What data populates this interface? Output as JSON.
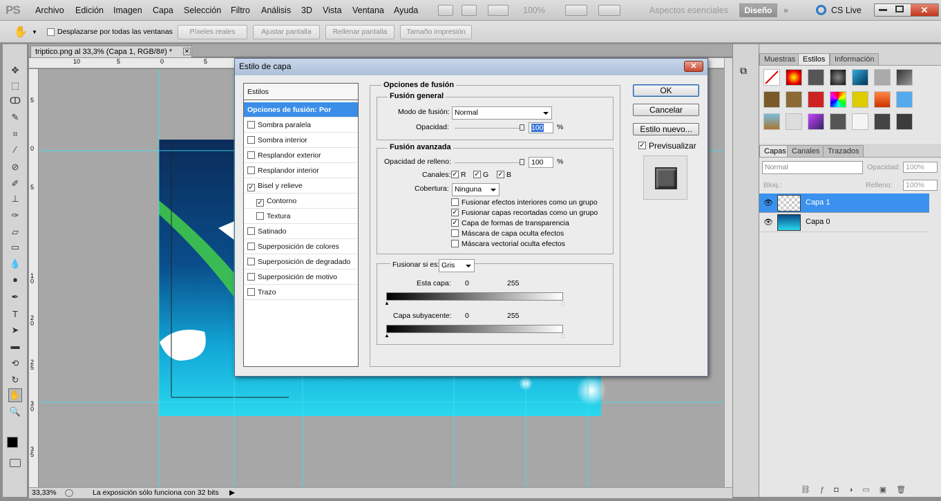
{
  "app": {
    "logo": "PS"
  },
  "menu": [
    "Archivo",
    "Edición",
    "Imagen",
    "Capa",
    "Selección",
    "Filtro",
    "Análisis",
    "3D",
    "Vista",
    "Ventana",
    "Ayuda"
  ],
  "menu_right": {
    "zoom": "100%",
    "workspace": "Aspectos esenciales",
    "design": "Diseño",
    "cslive": "CS Live"
  },
  "options": {
    "scroll_all": "Desplazarse por todas las ventanas",
    "buttons": [
      "Píxeles reales",
      "Ajustar pantalla",
      "Rellenar pantalla",
      "Tamaño impresión"
    ]
  },
  "document": {
    "tab": "triptico.png al 33,3% (Capa 1, RGB/8#) *"
  },
  "ruler_h": [
    "10",
    "5",
    "0",
    "5"
  ],
  "ruler_v": [
    "5",
    "0",
    "5",
    "1 0",
    "1 5",
    "2 0",
    "2 5",
    "3 0",
    "3 5"
  ],
  "status": {
    "zoom": "33,33%",
    "message": "La exposición sólo funciona con 32 bits"
  },
  "panels": {
    "top_tabs": [
      "Muestras",
      "Estilos",
      "Información"
    ],
    "layer_tabs": [
      "Capas",
      "Canales",
      "Trazados"
    ],
    "blend_mode": "Normal",
    "opacity_label": "Opacidad:",
    "opacity_value": "100%",
    "lock_label": "Bloq.:",
    "fill_label": "Relleno:",
    "fill_value": "100%",
    "layers": [
      {
        "name": "Capa 1"
      },
      {
        "name": "Capa 0"
      }
    ]
  },
  "dialog": {
    "title": "Estilo de capa",
    "styles_header": "Estilos",
    "style_items": [
      {
        "label": "Opciones de fusión: Por defecto",
        "selected": true
      },
      {
        "label": "Sombra paralela",
        "checked": false
      },
      {
        "label": "Sombra interior",
        "checked": false
      },
      {
        "label": "Resplandor exterior",
        "checked": false
      },
      {
        "label": "Resplandor interior",
        "checked": false
      },
      {
        "label": "Bisel y relieve",
        "checked": true
      },
      {
        "label": "Contorno",
        "checked": true,
        "indent": true
      },
      {
        "label": "Textura",
        "checked": false,
        "indent": true
      },
      {
        "label": "Satinado",
        "checked": false
      },
      {
        "label": "Superposición de colores",
        "checked": false
      },
      {
        "label": "Superposición de degradado",
        "checked": false
      },
      {
        "label": "Superposición de motivo",
        "checked": false
      },
      {
        "label": "Trazo",
        "checked": false
      }
    ],
    "section_title": "Opciones de fusión",
    "general": {
      "title": "Fusión general",
      "mode_label": "Modo de fusión:",
      "mode_value": "Normal",
      "opacity_label": "Opacidad:",
      "opacity_value": "100",
      "pct": "%"
    },
    "advanced": {
      "title": "Fusión avanzada",
      "fill_label": "Opacidad de relleno:",
      "fill_value": "100",
      "pct": "%",
      "channels_label": "Canales:",
      "ch_r": "R",
      "ch_g": "G",
      "ch_b": "B",
      "knockout_label": "Cobertura:",
      "knockout_value": "Ninguna",
      "options": [
        {
          "label": "Fusionar efectos interiores como un grupo",
          "checked": false
        },
        {
          "label": "Fusionar capas recortadas como un grupo",
          "checked": true
        },
        {
          "label": "Capa de formas de transparencia",
          "checked": true
        },
        {
          "label": "Máscara de capa oculta efectos",
          "checked": false
        },
        {
          "label": "Máscara vectorial oculta efectos",
          "checked": false
        }
      ]
    },
    "blendif": {
      "label": "Fusionar si es:",
      "value": "Gris",
      "this_layer": "Esta capa:",
      "underlying": "Capa subyacente:",
      "min": "0",
      "max": "255"
    },
    "buttons": {
      "ok": "OK",
      "cancel": "Cancelar",
      "new_style": "Estilo nuevo...",
      "preview": "Previsualizar"
    }
  }
}
